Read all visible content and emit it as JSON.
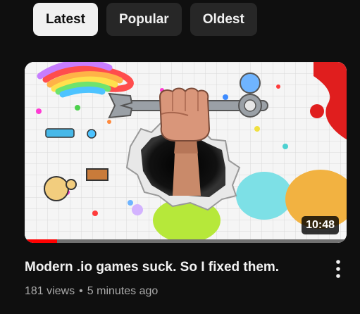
{
  "filters": {
    "chips": [
      {
        "label": "Latest",
        "active": true
      },
      {
        "label": "Popular",
        "active": false
      },
      {
        "label": "Oldest",
        "active": false
      }
    ]
  },
  "video": {
    "duration": "10:48",
    "watched_fraction": 0.1,
    "title": "Modern .io games suck. So I fixed them.",
    "views": "181 views",
    "separator": "•",
    "age": "5 minutes ago",
    "more_icon": "vertical-ellipsis-icon"
  },
  "colors": {
    "background": "#0f0f0f",
    "chip_active": "#f1f1f1",
    "chip_inactive": "#272727",
    "progress": "#ff0000"
  }
}
